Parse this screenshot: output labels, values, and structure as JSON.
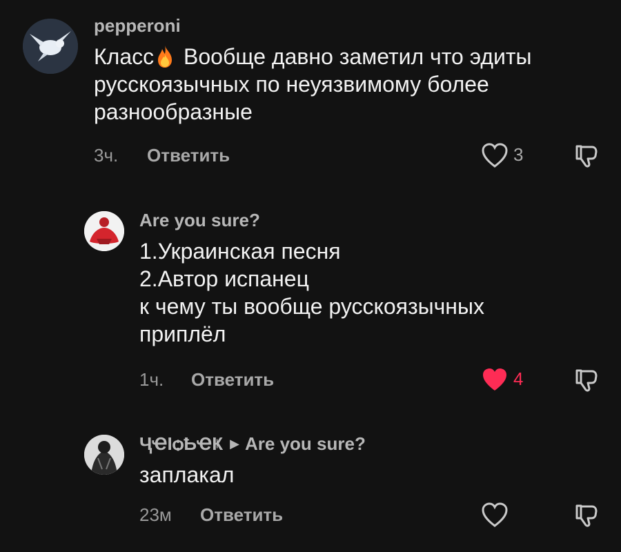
{
  "comments": [
    {
      "username": "pepperoni",
      "lines": [
        "Класс",
        " Вообще давно заметил что эдиты",
        "русскоязычных по неуязвимому более",
        "разнообразные"
      ],
      "time": "3ч.",
      "reply_label": "Ответить",
      "likes": "3",
      "liked": false,
      "emoji_icon": "fire-icon"
    },
    {
      "username": "Are you sure?",
      "lines": [
        "1.Украинская песня",
        "2.Автор испанец",
        "к чему ты вообще русскоязычных",
        "приплёл"
      ],
      "time": "1ч.",
      "reply_label": "Ответить",
      "likes": "4",
      "liked": true
    },
    {
      "username": "ҶҼƖѻҌҼҜ",
      "reply_to": "Are you sure?",
      "lines": [
        "заплакал"
      ],
      "time": "23м",
      "reply_label": "Ответить",
      "likes": "",
      "liked": false
    }
  ],
  "colors": {
    "background": "#121212",
    "text": "#f2f2f2",
    "muted": "#a9a9a9",
    "like_active": "#fe2c55"
  }
}
